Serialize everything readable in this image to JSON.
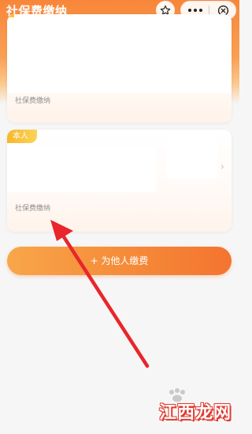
{
  "header": {
    "title": "社保费缴纳",
    "favorite_icon": "star-icon",
    "more_icon": "ellipsis-icon",
    "close_icon": "close-circle-icon"
  },
  "cards": [
    {
      "label": "社保费缴纳"
    },
    {
      "tag": "本人",
      "label": "社保费缴纳",
      "chevron": "›"
    }
  ],
  "pay_for_others_button": {
    "label": "+ 为他人缴费"
  },
  "annotation": {
    "color": "#e8262b"
  },
  "watermark": {
    "text": "江西龙网",
    "color": "#e13a30"
  }
}
